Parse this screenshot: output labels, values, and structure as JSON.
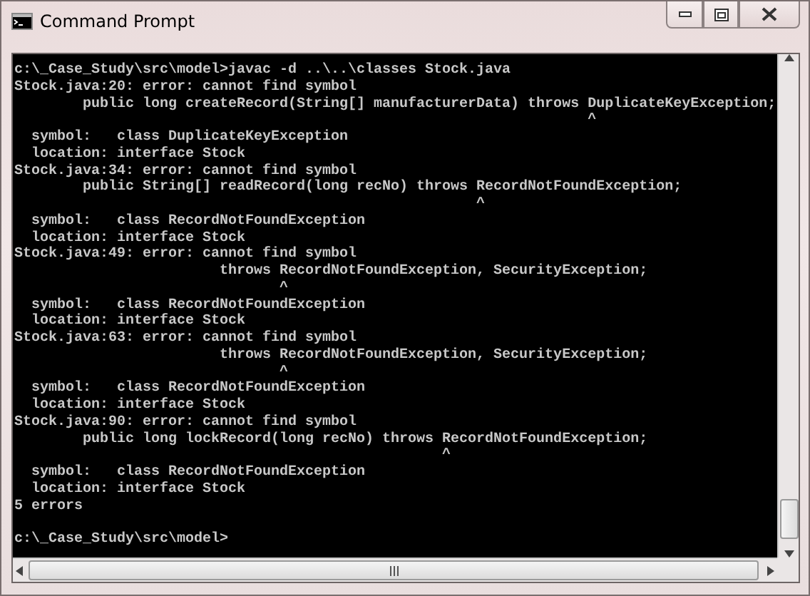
{
  "window": {
    "title": "Command Prompt"
  },
  "console": {
    "lines": [
      "c:\\_Case_Study\\src\\model>javac -d ..\\..\\classes Stock.java",
      "Stock.java:20: error: cannot find symbol",
      "        public long createRecord(String[] manufacturerData) throws DuplicateKeyException;",
      "                                                                   ^",
      "  symbol:   class DuplicateKeyException",
      "  location: interface Stock",
      "Stock.java:34: error: cannot find symbol",
      "        public String[] readRecord(long recNo) throws RecordNotFoundException;",
      "                                                      ^",
      "  symbol:   class RecordNotFoundException",
      "  location: interface Stock",
      "Stock.java:49: error: cannot find symbol",
      "                        throws RecordNotFoundException, SecurityException;",
      "                               ^",
      "  symbol:   class RecordNotFoundException",
      "  location: interface Stock",
      "Stock.java:63: error: cannot find symbol",
      "                        throws RecordNotFoundException, SecurityException;",
      "                               ^",
      "  symbol:   class RecordNotFoundException",
      "  location: interface Stock",
      "Stock.java:90: error: cannot find symbol",
      "        public long lockRecord(long recNo) throws RecordNotFoundException;",
      "                                                  ^",
      "  symbol:   class RecordNotFoundException",
      "  location: interface Stock",
      "5 errors"
    ],
    "prompt": "c:\\_Case_Study\\src\\model>"
  }
}
